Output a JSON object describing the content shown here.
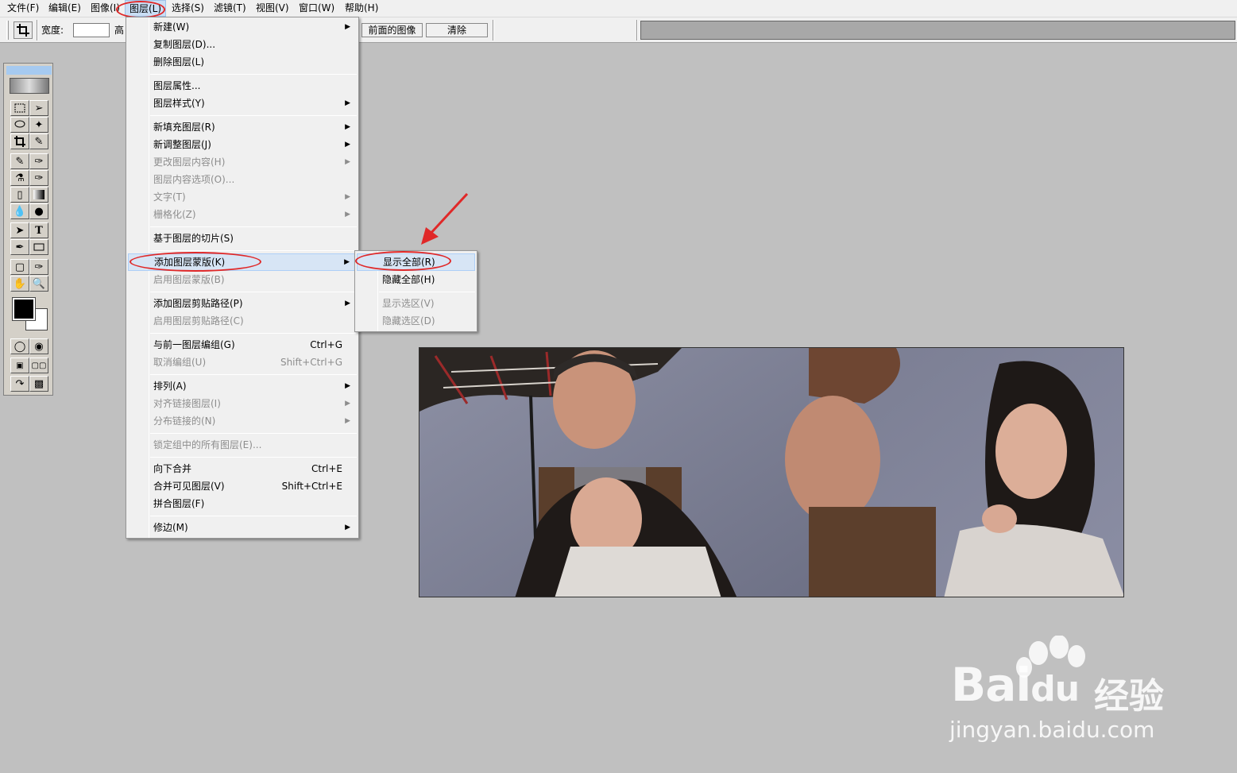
{
  "menubar": {
    "items": [
      "文件(F)",
      "编辑(E)",
      "图像(I)",
      "图层(L)",
      "选择(S)",
      "滤镜(T)",
      "视图(V)",
      "窗口(W)",
      "帮助(H)"
    ],
    "active_index": 3
  },
  "options_bar": {
    "width_label": "宽度:",
    "height_label_partial": "高",
    "front_image_button": "前面的图像",
    "clear_button": "清除"
  },
  "layer_menu": {
    "items": [
      {
        "label": "新建(W)",
        "submenu": true,
        "disabled": false
      },
      {
        "label": "复制图层(D)...",
        "disabled": false
      },
      {
        "label": "删除图层(L)",
        "disabled": false
      },
      {
        "label": "图层属性...",
        "disabled": false
      },
      {
        "label": "图层样式(Y)",
        "submenu": true,
        "disabled": false
      },
      {
        "label": "新填充图层(R)",
        "submenu": true,
        "disabled": false
      },
      {
        "label": "新调整图层(J)",
        "submenu": true,
        "disabled": false
      },
      {
        "label": "更改图层内容(H)",
        "submenu": true,
        "disabled": true
      },
      {
        "label": "图层内容选项(O)...",
        "disabled": true
      },
      {
        "label": "文字(T)",
        "submenu": true,
        "disabled": true
      },
      {
        "label": "栅格化(Z)",
        "submenu": true,
        "disabled": true
      },
      {
        "label": "基于图层的切片(S)",
        "disabled": false
      },
      {
        "label": "添加图层蒙版(K)",
        "submenu": true,
        "disabled": false,
        "highlighted": true
      },
      {
        "label": "启用图层蒙版(B)",
        "disabled": true
      },
      {
        "label": "添加图层剪贴路径(P)",
        "submenu": true,
        "disabled": false
      },
      {
        "label": "启用图层剪贴路径(C)",
        "disabled": true
      },
      {
        "label": "与前一图层编组(G)",
        "shortcut": "Ctrl+G",
        "disabled": false
      },
      {
        "label": "取消编组(U)",
        "shortcut": "Shift+Ctrl+G",
        "disabled": true
      },
      {
        "label": "排列(A)",
        "submenu": true,
        "disabled": false
      },
      {
        "label": "对齐链接图层(I)",
        "submenu": true,
        "disabled": true
      },
      {
        "label": "分布链接的(N)",
        "submenu": true,
        "disabled": true
      },
      {
        "label": "锁定组中的所有图层(E)...",
        "disabled": true
      },
      {
        "label": "向下合并",
        "shortcut": "Ctrl+E",
        "disabled": false
      },
      {
        "label": "合并可见图层(V)",
        "shortcut": "Shift+Ctrl+E",
        "disabled": false
      },
      {
        "label": "拼合图层(F)",
        "disabled": false
      },
      {
        "label": "修边(M)",
        "submenu": true,
        "disabled": false
      }
    ]
  },
  "mask_submenu": {
    "items": [
      {
        "label": "显示全部(R)",
        "disabled": false,
        "highlighted": true
      },
      {
        "label": "隐藏全部(H)",
        "disabled": false
      },
      {
        "label": "显示选区(V)",
        "disabled": true
      },
      {
        "label": "隐藏选区(D)",
        "disabled": true
      }
    ]
  },
  "watermark": {
    "brand": "Bai",
    "brand_du": "du",
    "cn": "经验",
    "url": "jingyan.baidu.com"
  },
  "colors": {
    "annotation_red": "#e02828",
    "workspace_gray": "#c0c0c0",
    "menu_bg": "#f0f0f0",
    "highlight_bg": "#d7e5f5"
  }
}
